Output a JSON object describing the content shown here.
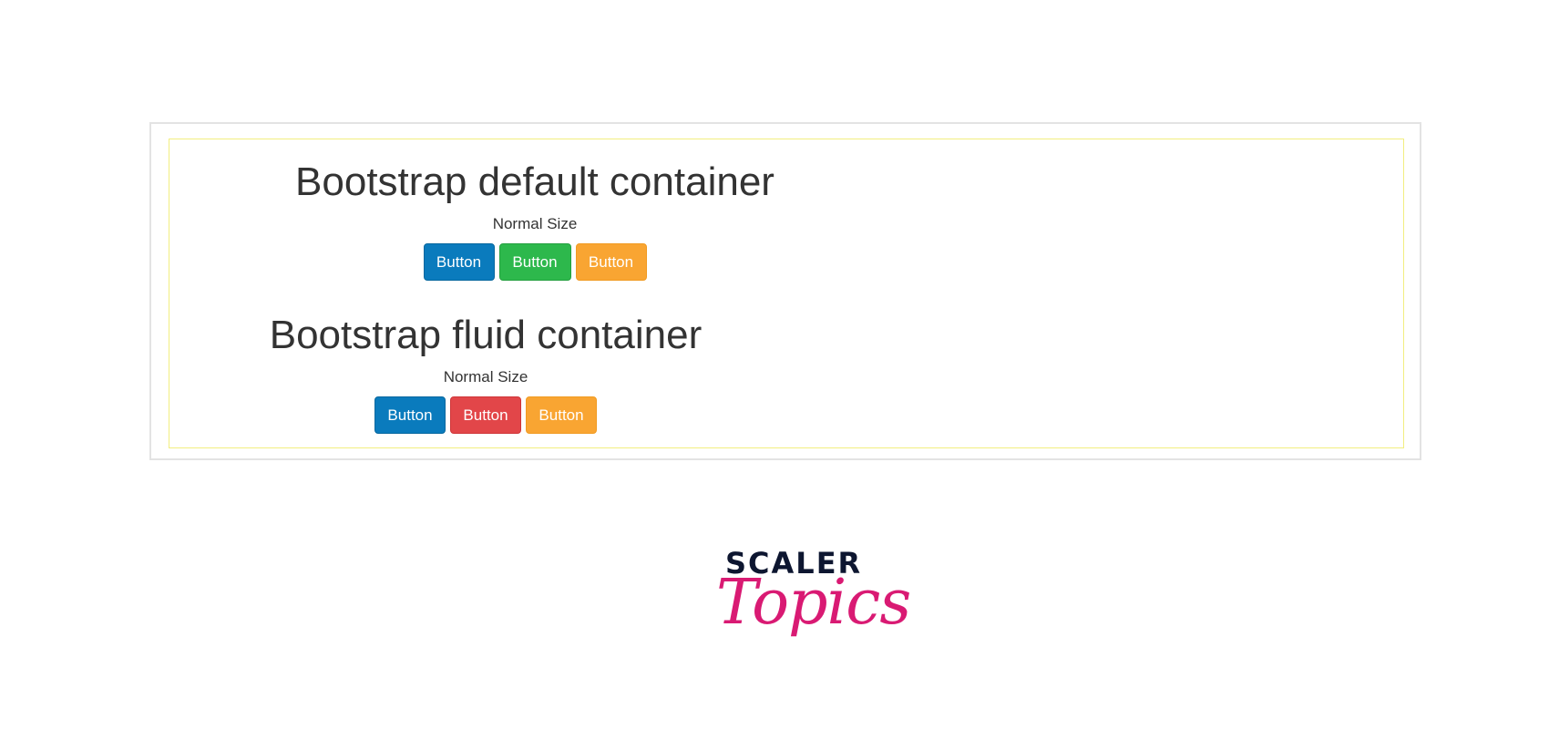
{
  "sections": {
    "default": {
      "heading": "Bootstrap default container",
      "subtitle": "Normal Size",
      "buttons": [
        "Button",
        "Button",
        "Button"
      ],
      "button_colors": [
        "#0a7bbd",
        "#2db84c",
        "#f9a532"
      ]
    },
    "fluid": {
      "heading": "Bootstrap fluid container",
      "subtitle": "Normal Size",
      "buttons": [
        "Button",
        "Button",
        "Button"
      ],
      "button_colors": [
        "#0a7bbd",
        "#e24649",
        "#f9a532"
      ]
    }
  },
  "logo": {
    "line1": "SCALER",
    "line2": "Topics",
    "colors": {
      "line1": "#0d1630",
      "line2": "#d91a73"
    }
  },
  "colors": {
    "outer_border": "#e3e3e3",
    "inner_border": "#f2ee80"
  }
}
